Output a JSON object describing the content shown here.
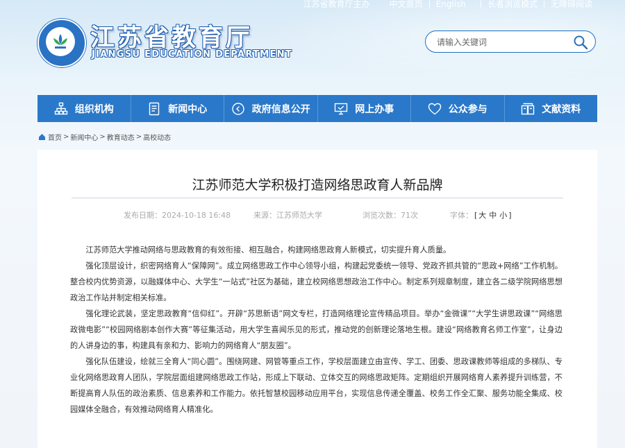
{
  "top_links": {
    "sponsor": "江苏省教育厅主办",
    "chinese": "中文首页",
    "english": "English",
    "elder": "长者浏览模式",
    "accessible": "无障碍阅读"
  },
  "header": {
    "title": "江苏省教育厅",
    "subtitle": "JIANGSU EDUCATION DEPARTMENT",
    "search_placeholder": "请输入关键词"
  },
  "nav": [
    {
      "label": "组织机构",
      "icon": "org-chart-icon"
    },
    {
      "label": "新闻中心",
      "icon": "document-icon"
    },
    {
      "label": "政府信息公开",
      "icon": "circle-arrow-icon"
    },
    {
      "label": "网上办事",
      "icon": "monitor-icon"
    },
    {
      "label": "公众参与",
      "icon": "heart-icon"
    },
    {
      "label": "文献资料",
      "icon": "books-icon"
    }
  ],
  "breadcrumb": [
    "首页",
    "新闻中心",
    "教育动态",
    "高校动态"
  ],
  "article": {
    "title": "江苏师范大学积极打造网络思政育人新品牌",
    "meta": {
      "date": "发布日期：2024-10-18 16:48",
      "source": "来源：江苏师范大学",
      "views": "浏览次数：71次",
      "font_label": "字体：",
      "size_large": "大",
      "size_medium": "中",
      "size_small": "小"
    },
    "paragraphs": [
      "江苏师范大学推动网络与思政教育的有效衔接、相互融合，构建网络思政育人新模式，切实提升育人质量。",
      "强化顶层设计，织密网络育人“保障网”。成立网络思政工作中心领导小组，构建起党委统一领导、党政齐抓共管的“思政+网络”工作机制。整合校内优势资源，以融媒体中心、大学生“一站式”社区为基础，建立校网络思想政治工作中心。制定系列规章制度，建立各二级学院网络思想政治工作站并制定相关标准。",
      "强化理论武装，坚定思政教育“信仰红”。开辟“苏思新语”网文专栏，打造网络理论宣传精品项目。举办“金微课”“大学生讲思政课”“网络思政微电影”“校园网络剧本创作大赛”等征集活动，用大学生喜闻乐见的形式，推动党的创新理论落地生根。建设“网络教育名师工作室”，让身边的人讲身边的事，构建具有亲和力、影响力的网络育人“朋友圈”。",
      "强化队伍建设，绘就三全育人“同心圆”。围绕网建、网管等重点工作，学校层面建立由宣传、学工、团委、思政课教师等组成的多梯队、专业化网络思政育人团队，学院层面组建网络思政工作站，形成上下联动、立体交互的网络思政矩阵。定期组织开展网络育人素养提升训练营，不断提高育人队伍的政治素质、信息素养和工作能力。依托智慧校园移动应用平台，实现信息传递全覆盖、校务工作全汇聚、服务功能全集成、校园媒体全融合，有效推动网络育人精准化。"
    ]
  },
  "colors": {
    "brand_blue": "#2a78c9",
    "nav_divider": "#5a9ad8",
    "page_bg": "#eef5fb"
  }
}
